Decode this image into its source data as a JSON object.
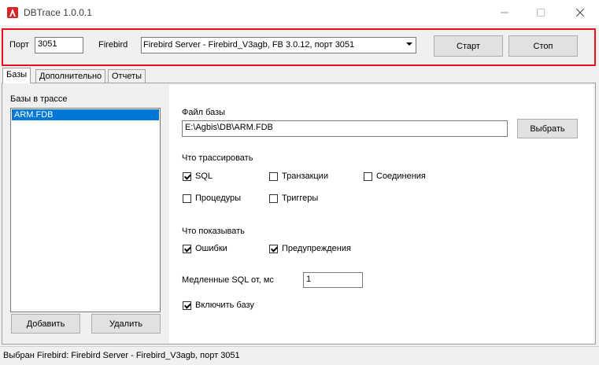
{
  "window": {
    "title": "DBTrace 1.0.0.1",
    "icon": "app-logo-icon",
    "controls": [
      "minimize-icon",
      "maximize-icon",
      "close-icon"
    ]
  },
  "toolbar": {
    "port_label": "Порт",
    "port_value": "3051",
    "firebird_label": "Firebird",
    "firebird_selected": "Firebird Server - Firebird_V3agb, FB 3.0.12, порт 3051",
    "start_label": "Старт",
    "stop_label": "Стоп",
    "highlight_color": "#e8101a"
  },
  "tabs": [
    {
      "label": "Базы",
      "active": true
    },
    {
      "label": "Дополнительно",
      "active": false
    },
    {
      "label": "Отчеты",
      "active": false
    }
  ],
  "databases": {
    "header": "Базы в трассе",
    "items": [
      "ARM.FDB"
    ],
    "add_label": "Добавить",
    "remove_label": "Удалить"
  },
  "details": {
    "file_label": "Файл базы",
    "file_value": "E:\\Agbis\\DB\\ARM.FDB",
    "browse_label": "Выбрать",
    "trace_header": "Что трассировать",
    "trace_options": [
      {
        "label": "SQL",
        "checked": true
      },
      {
        "label": "Транзакции",
        "checked": false
      },
      {
        "label": "Соединения",
        "checked": false
      },
      {
        "label": "Процедуры",
        "checked": false
      },
      {
        "label": "Триггеры",
        "checked": false
      }
    ],
    "show_header": "Что показывать",
    "show_options": [
      {
        "label": "Ошибки",
        "checked": true
      },
      {
        "label": "Предупреждения",
        "checked": true
      }
    ],
    "slow_sql_label": "Медленные SQL от, мс",
    "slow_sql_value": "1",
    "enable_label": "Включить базу",
    "enable_checked": true
  },
  "status": {
    "text": "Выбран Firebird: Firebird Server - Firebird_V3agb, порт 3051"
  }
}
